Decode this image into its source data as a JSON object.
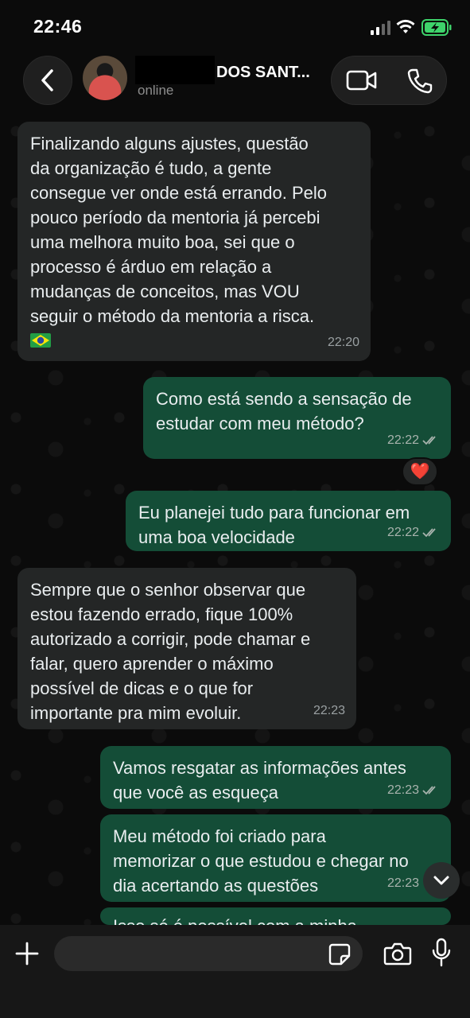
{
  "status_bar": {
    "time": "22:46"
  },
  "header": {
    "contact_name": "DOS SANT...",
    "contact_status": "online"
  },
  "messages": [
    {
      "direction": "in",
      "text": "Finalizando alguns ajustes, questão\nda organização é tudo, a gente\nconsegue ver onde está errando. Pelo\npouco período da mentoria já percebi\numa melhora muito boa, sei que o\nprocesso é árduo em relação a\nmudanças de conceitos, mas VOU\nseguir o método da mentoria a risca.",
      "emoji": "brazil-flag",
      "time": "22:20"
    },
    {
      "direction": "out",
      "text": "Como está sendo a sensação de\nestudar com meu método?",
      "time": "22:22",
      "reaction": "❤️"
    },
    {
      "direction": "out",
      "text": "Eu planejei tudo para funcionar em\numa boa velocidade",
      "time": "22:22"
    },
    {
      "direction": "in",
      "text": "Sempre que o senhor observar que\nestou fazendo errado, fique 100%\nautorizado a corrigir, pode chamar e\nfalar, quero aprender o máximo\npossível de dicas e o que for\nimportante pra mim evoluir.",
      "time": "22:23"
    },
    {
      "direction": "out",
      "text": "Vamos resgatar as informações antes\nque você as esqueça",
      "time": "22:23"
    },
    {
      "direction": "out",
      "text": "Meu método foi criado para\nmemorizar o que estudou e chegar no\ndia acertando as questões",
      "time": "22:23"
    },
    {
      "direction": "out",
      "text": "Isso só é possível com a minha",
      "time": ""
    }
  ],
  "composer": {
    "placeholder": ""
  },
  "colors": {
    "background": "#0b0b0b",
    "incoming_bubble": "#242626",
    "outgoing_bubble": "#144d37",
    "read_ticks": "#a8b3ad",
    "battery_green": "#3ed36b"
  }
}
